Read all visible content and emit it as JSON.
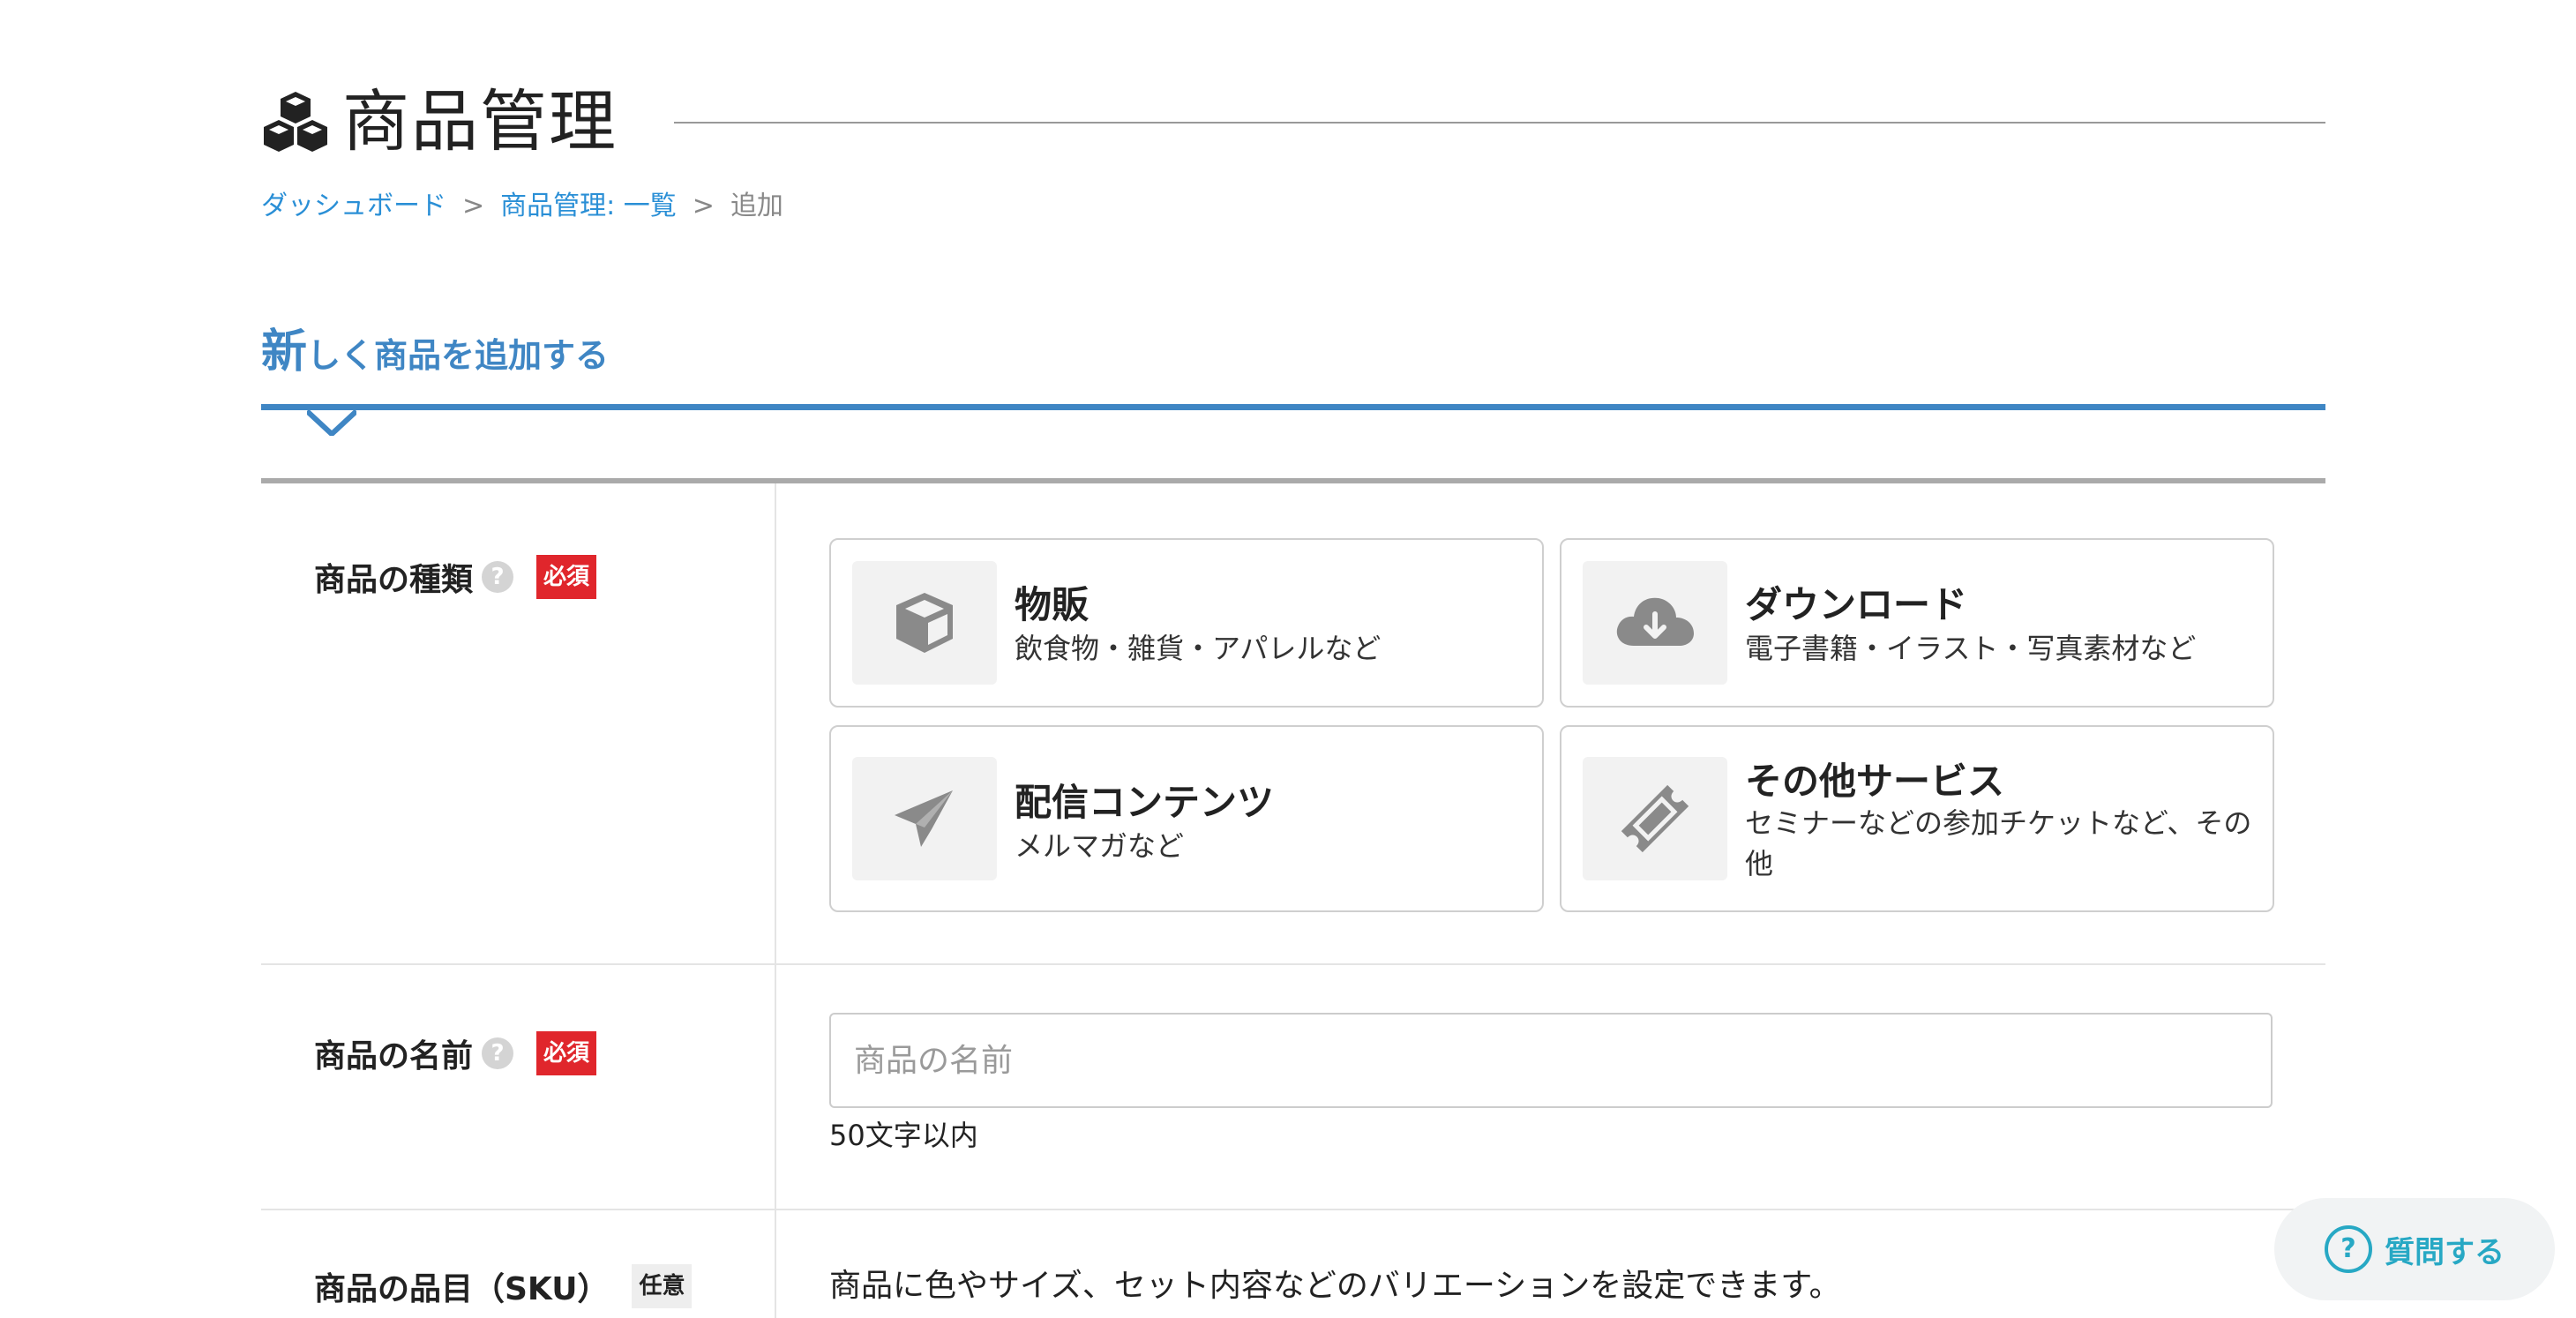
{
  "header": {
    "title": "商品管理",
    "icon": "cubes-icon"
  },
  "breadcrumb": {
    "items": [
      "ダッシュボード",
      "商品管理: 一覧",
      "追加"
    ],
    "separator": ">"
  },
  "section": {
    "title_first": "新",
    "title_rest": "しく商品を追加する"
  },
  "fields": {
    "type": {
      "label": "商品の種類",
      "help": "?",
      "badge": "必須",
      "options": [
        {
          "title": "物販",
          "desc": "飲食物・雑貨・アパレルなど",
          "icon": "box-icon"
        },
        {
          "title": "ダウンロード",
          "desc": "電子書籍・イラスト・写真素材など",
          "icon": "cloud-download-icon"
        },
        {
          "title": "配信コンテンツ",
          "desc": "メルマガなど",
          "icon": "paper-plane-icon"
        },
        {
          "title": "その他サービス",
          "desc": "セミナーなどの参加チケットなど、その他",
          "icon": "ticket-icon"
        }
      ]
    },
    "name": {
      "label": "商品の名前",
      "help": "?",
      "badge": "必須",
      "value": "",
      "placeholder": "商品の名前",
      "hint": "50文字以内"
    },
    "sku": {
      "label": "商品の品目（SKU）",
      "badge": "任意",
      "desc": "商品に色やサイズ、セット内容などのバリエーションを設定できます。"
    }
  },
  "help_button": {
    "icon": "question-circle-icon",
    "label": "質問する"
  },
  "colors": {
    "accent": "#3f86c4",
    "link": "#2a8fd6",
    "required": "#e0262c",
    "help": "#27a8c4"
  }
}
